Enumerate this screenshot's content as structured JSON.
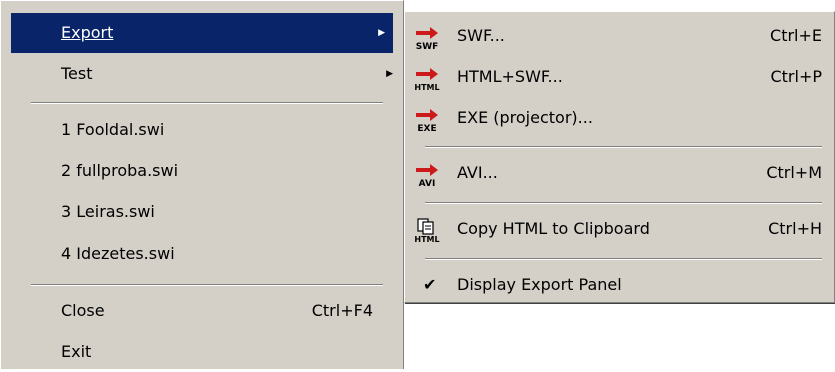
{
  "file_menu": {
    "items": [
      {
        "label": "Export",
        "has_submenu": true,
        "highlighted": true
      },
      {
        "label": "Test",
        "has_submenu": true
      },
      {
        "label": "1 Fooldal.swi"
      },
      {
        "label": "2 fullproba.swi"
      },
      {
        "label": "3 Leiras.swi"
      },
      {
        "label": "4 Idezetes.swi"
      },
      {
        "label": "Close",
        "shortcut": "Ctrl+F4"
      },
      {
        "label": "Exit"
      }
    ]
  },
  "export_menu": {
    "items": [
      {
        "label": "SWF...",
        "shortcut": "Ctrl+E",
        "icon": "swf-export-icon",
        "icon_text": "SWF"
      },
      {
        "label": "HTML+SWF...",
        "shortcut": "Ctrl+P",
        "icon": "html-export-icon",
        "icon_text": "HTML"
      },
      {
        "label": "EXE (projector)...",
        "shortcut": "",
        "icon": "exe-export-icon",
        "icon_text": "EXE"
      },
      {
        "label": "AVI...",
        "shortcut": "Ctrl+M",
        "icon": "avi-export-icon",
        "icon_text": "AVI"
      },
      {
        "label": "Copy HTML to Clipboard",
        "shortcut": "Ctrl+H",
        "icon": "copy-html-icon",
        "icon_text": "HTML"
      },
      {
        "label": "Display Export Panel",
        "shortcut": "",
        "icon": "checkmark-icon",
        "checked": true
      }
    ]
  },
  "colors": {
    "menu_bg": "#d4d0c8",
    "highlight": "#0a246a",
    "arrow_red": "#cc1a1a"
  }
}
